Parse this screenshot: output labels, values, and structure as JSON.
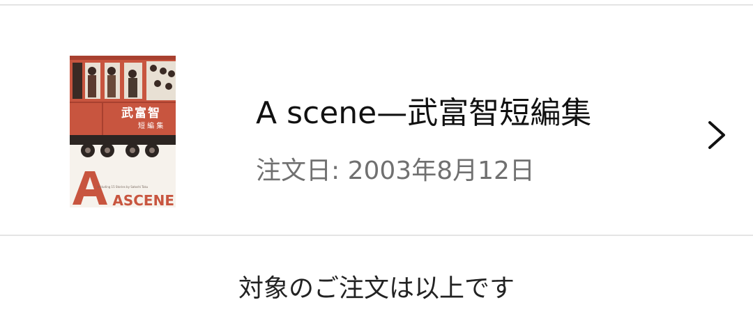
{
  "order": {
    "title": "A scene—武富智短編集",
    "order_date": "注文日: 2003年8月12日",
    "cover": {
      "cover_title": "武富智",
      "cover_subtitle": "短 編 集",
      "cover_logo": "ASCENE",
      "cover_tagline": "Including 15 Stories by Satoshi Taku",
      "train_color": "#c8553f"
    },
    "chevron_icon": "chevron-right-icon"
  },
  "footer": {
    "end_message": "対象のご注文は以上です"
  },
  "colors": {
    "divider": "#e4e4e4",
    "secondary_text": "#707070",
    "primary_text": "#111111"
  }
}
